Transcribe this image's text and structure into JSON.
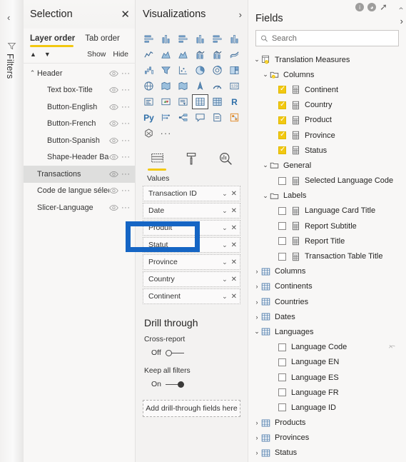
{
  "filters_rail": {
    "label": "Filters",
    "collapse_icon": "chevron-left-icon",
    "funnel_icon": "filter-funnel-icon"
  },
  "selection": {
    "title": "Selection",
    "close_label": "✕",
    "tabs": [
      {
        "label": "Layer order",
        "active": true
      },
      {
        "label": "Tab order",
        "active": false
      }
    ],
    "sort_up": "▲",
    "sort_down": "▼",
    "show_label": "Show",
    "hide_label": "Hide",
    "items": [
      {
        "label": "Header",
        "expander": "⌃",
        "indent": false,
        "selected": false
      },
      {
        "label": "Text box-Title",
        "expander": "",
        "indent": true,
        "selected": false
      },
      {
        "label": "Button-English",
        "expander": "",
        "indent": true,
        "selected": false
      },
      {
        "label": "Button-French",
        "expander": "",
        "indent": true,
        "selected": false
      },
      {
        "label": "Button-Spanish",
        "expander": "",
        "indent": true,
        "selected": false
      },
      {
        "label": "Shape-Header Ba...",
        "expander": "",
        "indent": true,
        "selected": false
      },
      {
        "label": "Transactions",
        "expander": "",
        "indent": false,
        "selected": true
      },
      {
        "label": "Code de langue sélec...",
        "expander": "",
        "indent": false,
        "selected": false
      },
      {
        "label": "Slicer-Language",
        "expander": "",
        "indent": false,
        "selected": false
      }
    ]
  },
  "visualizations": {
    "title": "Visualizations",
    "expand_icon": "chevron-right-icon",
    "icons": [
      "stacked-bar-chart-icon",
      "stacked-column-chart-icon",
      "clustered-bar-chart-icon",
      "clustered-column-chart-icon",
      "100-stacked-bar-chart-icon",
      "100-stacked-column-chart-icon",
      "line-chart-icon",
      "area-chart-icon",
      "stacked-area-chart-icon",
      "line-stacked-column-icon",
      "line-clustered-column-icon",
      "ribbon-chart-icon",
      "waterfall-chart-icon",
      "funnel-chart-icon",
      "scatter-chart-icon",
      "pie-chart-icon",
      "donut-chart-icon",
      "treemap-icon",
      "map-icon",
      "filled-map-icon",
      "shape-map-icon",
      "azure-map-icon",
      "gauge-icon",
      "card-icon",
      "multi-row-card-icon",
      "kpi-icon",
      "slicer-icon",
      "table-icon",
      "matrix-icon",
      "r-script-visual-icon",
      "python-visual-icon",
      "key-influencers-icon",
      "decomposition-tree-icon",
      "qa-visual-icon",
      "paginated-report-icon",
      "power-apps-icon",
      "smart-narrative-icon",
      "more-options-icon"
    ],
    "selected_icon": "table-icon",
    "well_tabs": [
      {
        "name": "fields-tab",
        "active": true
      },
      {
        "name": "format-paint-roller-tab",
        "active": false
      },
      {
        "name": "analytics-magnifier-tab",
        "active": false
      }
    ],
    "wells_label": "Values",
    "wells": [
      {
        "label": "Transaction ID"
      },
      {
        "label": "Date"
      },
      {
        "label": "Produit"
      },
      {
        "label": "Statut"
      },
      {
        "label": "Province"
      },
      {
        "label": "Country"
      },
      {
        "label": "Continent"
      }
    ],
    "highlight": {
      "target": "Statut",
      "color": "#1565c4"
    },
    "drill": {
      "title": "Drill through",
      "cross_report_label": "Cross-report",
      "cross_report_state": "Off",
      "keep_filters_label": "Keep all filters",
      "keep_filters_state": "On",
      "dropzone_label": "Add drill-through fields here"
    }
  },
  "fields": {
    "title": "Fields",
    "top_icons": [
      "info-icon",
      "clock-icon",
      "share-arrow-icon"
    ],
    "expand_icon": "chevron-right-icon",
    "search": {
      "placeholder": "Search",
      "value": "",
      "icon": "search-icon"
    },
    "tree": [
      {
        "label": "Translation Measures",
        "level": 0,
        "twisty": "⌄",
        "icon": "measure-table-icon",
        "checkbox": null
      },
      {
        "label": "Columns",
        "level": 1,
        "twisty": "⌄",
        "icon": "folder-measure-icon",
        "checkbox": null
      },
      {
        "label": "Continent",
        "level": 2,
        "twisty": "",
        "icon": "measure-icon",
        "checkbox": "checked"
      },
      {
        "label": "Country",
        "level": 2,
        "twisty": "",
        "icon": "measure-icon",
        "checkbox": "checked"
      },
      {
        "label": "Product",
        "level": 2,
        "twisty": "",
        "icon": "measure-icon",
        "checkbox": "checked"
      },
      {
        "label": "Province",
        "level": 2,
        "twisty": "",
        "icon": "measure-icon",
        "checkbox": "checked"
      },
      {
        "label": "Status",
        "level": 2,
        "twisty": "",
        "icon": "measure-icon",
        "checkbox": "checked"
      },
      {
        "label": "General",
        "level": 1,
        "twisty": "⌄",
        "icon": "folder-icon",
        "checkbox": null
      },
      {
        "label": "Selected Language Code",
        "level": 2,
        "twisty": "",
        "icon": "measure-icon",
        "checkbox": "unchecked"
      },
      {
        "label": "Labels",
        "level": 1,
        "twisty": "⌄",
        "icon": "folder-icon",
        "checkbox": null
      },
      {
        "label": "Language Card Title",
        "level": 2,
        "twisty": "",
        "icon": "measure-icon",
        "checkbox": "unchecked"
      },
      {
        "label": "Report Subtitle",
        "level": 2,
        "twisty": "",
        "icon": "measure-icon",
        "checkbox": "unchecked"
      },
      {
        "label": "Report Title",
        "level": 2,
        "twisty": "",
        "icon": "measure-icon",
        "checkbox": "unchecked"
      },
      {
        "label": "Transaction Table Title",
        "level": 2,
        "twisty": "",
        "icon": "measure-icon",
        "checkbox": "unchecked"
      },
      {
        "label": "Columns",
        "level": 0,
        "twisty": "›",
        "icon": "table-grid-icon",
        "checkbox": null
      },
      {
        "label": "Continents",
        "level": 0,
        "twisty": "›",
        "icon": "table-grid-icon",
        "checkbox": null
      },
      {
        "label": "Countries",
        "level": 0,
        "twisty": "›",
        "icon": "table-grid-icon",
        "checkbox": null
      },
      {
        "label": "Dates",
        "level": 0,
        "twisty": "›",
        "icon": "table-grid-icon",
        "checkbox": null
      },
      {
        "label": "Languages",
        "level": 0,
        "twisty": "⌄",
        "icon": "table-grid-icon",
        "checkbox": null
      },
      {
        "label": "Language Code",
        "level": 2,
        "twisty": "",
        "icon": "",
        "checkbox": "unchecked",
        "hidden_eye": true
      },
      {
        "label": "Language EN",
        "level": 2,
        "twisty": "",
        "icon": "",
        "checkbox": "unchecked"
      },
      {
        "label": "Language ES",
        "level": 2,
        "twisty": "",
        "icon": "",
        "checkbox": "unchecked"
      },
      {
        "label": "Language FR",
        "level": 2,
        "twisty": "",
        "icon": "",
        "checkbox": "unchecked"
      },
      {
        "label": "Language ID",
        "level": 2,
        "twisty": "",
        "icon": "",
        "checkbox": "unchecked"
      },
      {
        "label": "Products",
        "level": 0,
        "twisty": "›",
        "icon": "table-grid-icon",
        "checkbox": null
      },
      {
        "label": "Provinces",
        "level": 0,
        "twisty": "›",
        "icon": "table-grid-icon",
        "checkbox": null
      },
      {
        "label": "Status",
        "level": 0,
        "twisty": "›",
        "icon": "table-grid-icon",
        "checkbox": null
      }
    ]
  }
}
